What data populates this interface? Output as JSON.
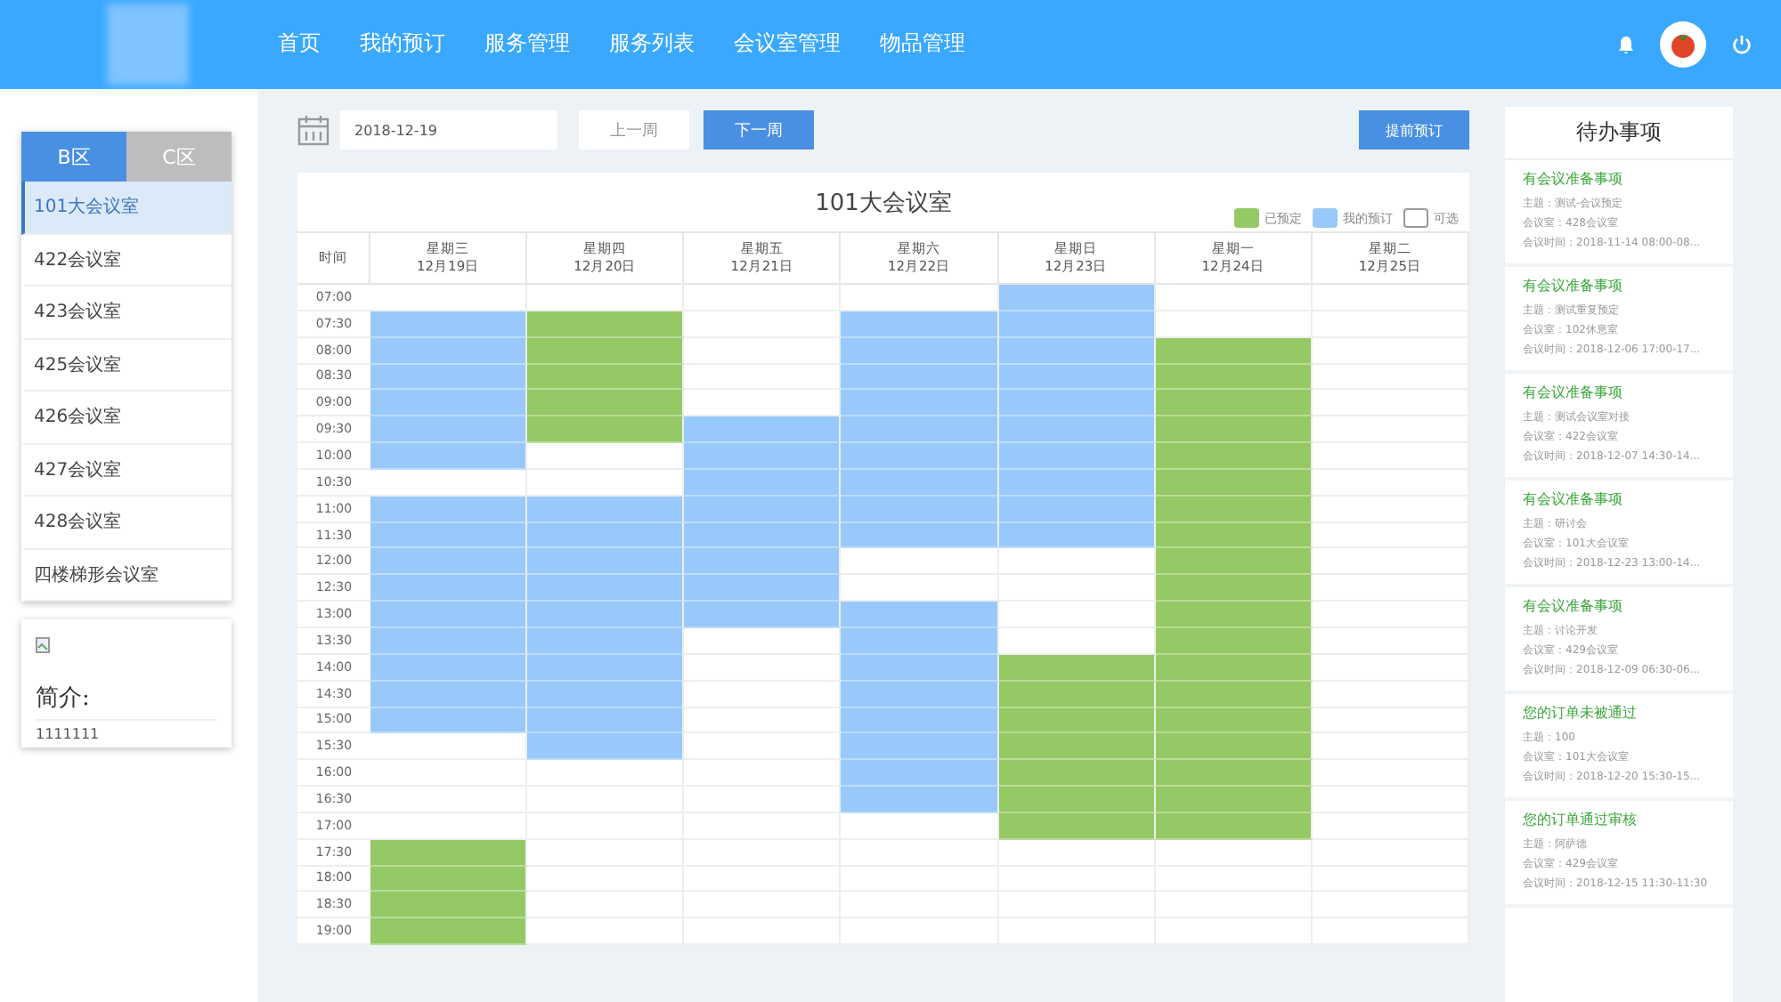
{
  "nav": {
    "items": [
      {
        "label": "首页",
        "selected": false
      },
      {
        "label": "我的预订",
        "selected": false
      },
      {
        "label": "服务管理",
        "selected": false
      },
      {
        "label": "服务列表",
        "selected": false
      },
      {
        "label": "会议室管理",
        "selected": false
      },
      {
        "label": "物品管理",
        "selected": false
      }
    ]
  },
  "sidebar": {
    "tabs": [
      {
        "label": "B区",
        "selected": true
      },
      {
        "label": "C区",
        "selected": false
      }
    ],
    "rooms": [
      {
        "label": "101大会议室",
        "selected": true
      },
      {
        "label": "422会议室",
        "selected": false
      },
      {
        "label": "423会议室",
        "selected": false
      },
      {
        "label": "425会议室",
        "selected": false
      },
      {
        "label": "426会议室",
        "selected": false
      },
      {
        "label": "427会议室",
        "selected": false
      },
      {
        "label": "428会议室",
        "selected": false
      },
      {
        "label": "四楼梯形会议室",
        "selected": false
      }
    ],
    "intro": {
      "title": "简介:",
      "text": "1111111"
    }
  },
  "toolbar": {
    "date": "2018-12-19",
    "prev": "上一周",
    "next": "下一周",
    "action": "提前预订"
  },
  "schedule": {
    "title": "101大会议室",
    "legend": [
      {
        "label": "已预定",
        "kind": "booked"
      },
      {
        "label": "我的预订",
        "kind": "mine"
      },
      {
        "label": "可选",
        "kind": "free"
      }
    ],
    "time_header": "时间",
    "times": [
      "07:00",
      "07:30",
      "08:00",
      "08:30",
      "09:00",
      "09:30",
      "10:00",
      "10:30",
      "11:00",
      "11:30",
      "12:00",
      "12:30",
      "13:00",
      "13:30",
      "14:00",
      "14:30",
      "15:00",
      "15:30",
      "16:00",
      "16:30",
      "17:00",
      "17:30",
      "18:00",
      "18:30",
      "19:00"
    ],
    "days": [
      {
        "weekday": "星期三",
        "date": "12月19日",
        "slots": [
          {
            "kind": "free"
          },
          {
            "kind": "mine"
          },
          {
            "kind": "mine"
          },
          {
            "kind": "mine"
          },
          {
            "kind": "mine"
          },
          {
            "kind": "mine"
          },
          {
            "kind": "mine"
          },
          {
            "kind": "free"
          },
          {
            "kind": "mine"
          },
          {
            "kind": "mine"
          },
          {
            "kind": "mine"
          },
          {
            "kind": "mine"
          },
          {
            "kind": "mine"
          },
          {
            "kind": "mine"
          },
          {
            "kind": "mine"
          },
          {
            "kind": "mine"
          },
          {
            "kind": "mine"
          },
          {
            "kind": "free"
          },
          {
            "kind": "free"
          },
          {
            "kind": "free"
          },
          {
            "kind": "free"
          },
          {
            "kind": "booked"
          },
          {
            "kind": "booked"
          },
          {
            "kind": "booked"
          },
          {
            "kind": "booked"
          }
        ]
      },
      {
        "weekday": "星期四",
        "date": "12月20日",
        "slots": [
          {
            "kind": "free"
          },
          {
            "kind": "booked"
          },
          {
            "kind": "booked"
          },
          {
            "kind": "booked"
          },
          {
            "kind": "booked"
          },
          {
            "kind": "booked"
          },
          {
            "kind": "free"
          },
          {
            "kind": "free"
          },
          {
            "kind": "mine"
          },
          {
            "kind": "mine"
          },
          {
            "kind": "mine"
          },
          {
            "kind": "mine"
          },
          {
            "kind": "mine"
          },
          {
            "kind": "mine"
          },
          {
            "kind": "mine"
          },
          {
            "kind": "mine"
          },
          {
            "kind": "mine"
          },
          {
            "kind": "mine"
          },
          {
            "kind": "free"
          },
          {
            "kind": "free"
          },
          {
            "kind": "free"
          },
          {
            "kind": "free"
          },
          {
            "kind": "free"
          },
          {
            "kind": "free"
          },
          {
            "kind": "free"
          }
        ]
      },
      {
        "weekday": "星期五",
        "date": "12月21日",
        "slots": [
          {
            "kind": "free"
          },
          {
            "kind": "free"
          },
          {
            "kind": "free"
          },
          {
            "kind": "free"
          },
          {
            "kind": "free"
          },
          {
            "kind": "mine"
          },
          {
            "kind": "mine"
          },
          {
            "kind": "mine"
          },
          {
            "kind": "mine"
          },
          {
            "kind": "mine"
          },
          {
            "kind": "mine"
          },
          {
            "kind": "mine"
          },
          {
            "kind": "mine"
          },
          {
            "kind": "free"
          },
          {
            "kind": "free"
          },
          {
            "kind": "free"
          },
          {
            "kind": "free"
          },
          {
            "kind": "free"
          },
          {
            "kind": "free"
          },
          {
            "kind": "free"
          },
          {
            "kind": "free"
          },
          {
            "kind": "free"
          },
          {
            "kind": "free"
          },
          {
            "kind": "free"
          },
          {
            "kind": "free"
          }
        ]
      },
      {
        "weekday": "星期六",
        "date": "12月22日",
        "slots": [
          {
            "kind": "free"
          },
          {
            "kind": "mine"
          },
          {
            "kind": "mine"
          },
          {
            "kind": "mine"
          },
          {
            "kind": "mine"
          },
          {
            "kind": "mine"
          },
          {
            "kind": "mine"
          },
          {
            "kind": "mine"
          },
          {
            "kind": "mine"
          },
          {
            "kind": "mine"
          },
          {
            "kind": "free"
          },
          {
            "kind": "free"
          },
          {
            "kind": "mine"
          },
          {
            "kind": "mine"
          },
          {
            "kind": "mine"
          },
          {
            "kind": "mine"
          },
          {
            "kind": "mine"
          },
          {
            "kind": "mine"
          },
          {
            "kind": "mine"
          },
          {
            "kind": "mine"
          },
          {
            "kind": "free"
          },
          {
            "kind": "free"
          },
          {
            "kind": "free"
          },
          {
            "kind": "free"
          },
          {
            "kind": "free"
          }
        ]
      },
      {
        "weekday": "星期日",
        "date": "12月23日",
        "slots": [
          {
            "kind": "mine"
          },
          {
            "kind": "mine"
          },
          {
            "kind": "mine"
          },
          {
            "kind": "mine"
          },
          {
            "kind": "mine"
          },
          {
            "kind": "mine"
          },
          {
            "kind": "mine"
          },
          {
            "kind": "mine"
          },
          {
            "kind": "mine"
          },
          {
            "kind": "mine"
          },
          {
            "kind": "free"
          },
          {
            "kind": "free"
          },
          {
            "kind": "free"
          },
          {
            "kind": "free"
          },
          {
            "kind": "booked"
          },
          {
            "kind": "booked"
          },
          {
            "kind": "booked"
          },
          {
            "kind": "booked"
          },
          {
            "kind": "booked"
          },
          {
            "kind": "booked"
          },
          {
            "kind": "booked"
          },
          {
            "kind": "free"
          },
          {
            "kind": "free"
          },
          {
            "kind": "free"
          },
          {
            "kind": "free"
          }
        ]
      },
      {
        "weekday": "星期一",
        "date": "12月24日",
        "slots": [
          {
            "kind": "free"
          },
          {
            "kind": "free"
          },
          {
            "kind": "booked"
          },
          {
            "kind": "booked"
          },
          {
            "kind": "booked"
          },
          {
            "kind": "booked"
          },
          {
            "kind": "booked"
          },
          {
            "kind": "booked"
          },
          {
            "kind": "booked"
          },
          {
            "kind": "booked"
          },
          {
            "kind": "booked"
          },
          {
            "kind": "booked"
          },
          {
            "kind": "booked"
          },
          {
            "kind": "booked"
          },
          {
            "kind": "booked"
          },
          {
            "kind": "booked"
          },
          {
            "kind": "booked"
          },
          {
            "kind": "booked"
          },
          {
            "kind": "booked"
          },
          {
            "kind": "booked"
          },
          {
            "kind": "booked"
          },
          {
            "kind": "free"
          },
          {
            "kind": "free"
          },
          {
            "kind": "free"
          },
          {
            "kind": "free"
          }
        ]
      },
      {
        "weekday": "星期二",
        "date": "12月25日",
        "slots": [
          {
            "kind": "free"
          },
          {
            "kind": "free"
          },
          {
            "kind": "free"
          },
          {
            "kind": "free"
          },
          {
            "kind": "free"
          },
          {
            "kind": "free"
          },
          {
            "kind": "free"
          },
          {
            "kind": "free"
          },
          {
            "kind": "free"
          },
          {
            "kind": "free"
          },
          {
            "kind": "free"
          },
          {
            "kind": "free"
          },
          {
            "kind": "free"
          },
          {
            "kind": "free"
          },
          {
            "kind": "free"
          },
          {
            "kind": "free"
          },
          {
            "kind": "free"
          },
          {
            "kind": "free"
          },
          {
            "kind": "free"
          },
          {
            "kind": "free"
          },
          {
            "kind": "free"
          },
          {
            "kind": "free"
          },
          {
            "kind": "free"
          },
          {
            "kind": "free"
          },
          {
            "kind": "free"
          }
        ]
      }
    ]
  },
  "todo": {
    "title": "待办事项",
    "items": [
      {
        "title": "有会议准备事项",
        "lines": [
          "主题：测试-会议预定",
          "会议室：428会议室",
          "会议时间：2018-11-14 08:00-08..."
        ]
      },
      {
        "title": "有会议准备事项",
        "lines": [
          "主题：测试重复预定",
          "会议室：102休息室",
          "会议时间：2018-12-06 17:00-17..."
        ]
      },
      {
        "title": "有会议准备事项",
        "lines": [
          "主题：测试会议室对接",
          "会议室：422会议室",
          "会议时间：2018-12-07 14:30-14..."
        ]
      },
      {
        "title": "有会议准备事项",
        "lines": [
          "主题：研讨会",
          "会议室：101大会议室",
          "会议时间：2018-12-23 13:00-14..."
        ]
      },
      {
        "title": "有会议准备事项",
        "lines": [
          "主题：讨论开发",
          "会议室：429会议室",
          "会议时间：2018-12-09 06:30-06..."
        ]
      },
      {
        "title": "您的订单未被通过",
        "lines": [
          "主题：100",
          "会议室：101大会议室",
          "会议时间：2018-12-20 15:30-15..."
        ]
      },
      {
        "title": "您的订单通过审核",
        "lines": [
          "主题：阿萨德",
          "会议室：429会议室",
          "会议时间：2018-12-15 11:30-11:30"
        ]
      }
    ]
  }
}
